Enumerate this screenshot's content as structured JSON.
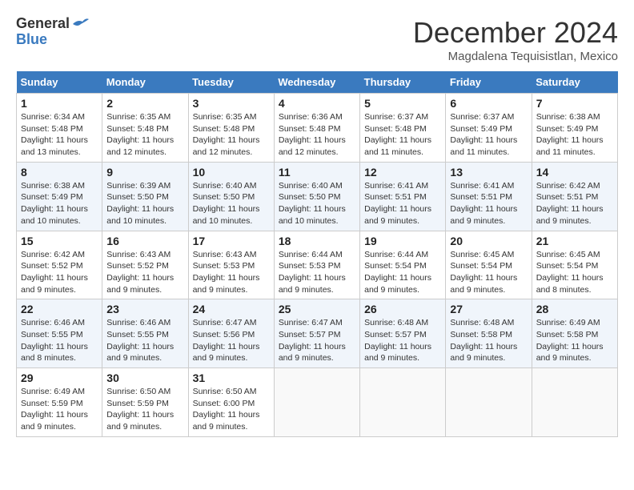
{
  "header": {
    "logo_line1": "General",
    "logo_line2": "Blue",
    "month_title": "December 2024",
    "location": "Magdalena Tequisistlan, Mexico"
  },
  "weekdays": [
    "Sunday",
    "Monday",
    "Tuesday",
    "Wednesday",
    "Thursday",
    "Friday",
    "Saturday"
  ],
  "weeks": [
    [
      {
        "day": "1",
        "sunrise": "6:34 AM",
        "sunset": "5:48 PM",
        "daylight": "11 hours and 13 minutes."
      },
      {
        "day": "2",
        "sunrise": "6:35 AM",
        "sunset": "5:48 PM",
        "daylight": "11 hours and 12 minutes."
      },
      {
        "day": "3",
        "sunrise": "6:35 AM",
        "sunset": "5:48 PM",
        "daylight": "11 hours and 12 minutes."
      },
      {
        "day": "4",
        "sunrise": "6:36 AM",
        "sunset": "5:48 PM",
        "daylight": "11 hours and 12 minutes."
      },
      {
        "day": "5",
        "sunrise": "6:37 AM",
        "sunset": "5:48 PM",
        "daylight": "11 hours and 11 minutes."
      },
      {
        "day": "6",
        "sunrise": "6:37 AM",
        "sunset": "5:49 PM",
        "daylight": "11 hours and 11 minutes."
      },
      {
        "day": "7",
        "sunrise": "6:38 AM",
        "sunset": "5:49 PM",
        "daylight": "11 hours and 11 minutes."
      }
    ],
    [
      {
        "day": "8",
        "sunrise": "6:38 AM",
        "sunset": "5:49 PM",
        "daylight": "11 hours and 10 minutes."
      },
      {
        "day": "9",
        "sunrise": "6:39 AM",
        "sunset": "5:50 PM",
        "daylight": "11 hours and 10 minutes."
      },
      {
        "day": "10",
        "sunrise": "6:40 AM",
        "sunset": "5:50 PM",
        "daylight": "11 hours and 10 minutes."
      },
      {
        "day": "11",
        "sunrise": "6:40 AM",
        "sunset": "5:50 PM",
        "daylight": "11 hours and 10 minutes."
      },
      {
        "day": "12",
        "sunrise": "6:41 AM",
        "sunset": "5:51 PM",
        "daylight": "11 hours and 9 minutes."
      },
      {
        "day": "13",
        "sunrise": "6:41 AM",
        "sunset": "5:51 PM",
        "daylight": "11 hours and 9 minutes."
      },
      {
        "day": "14",
        "sunrise": "6:42 AM",
        "sunset": "5:51 PM",
        "daylight": "11 hours and 9 minutes."
      }
    ],
    [
      {
        "day": "15",
        "sunrise": "6:42 AM",
        "sunset": "5:52 PM",
        "daylight": "11 hours and 9 minutes."
      },
      {
        "day": "16",
        "sunrise": "6:43 AM",
        "sunset": "5:52 PM",
        "daylight": "11 hours and 9 minutes."
      },
      {
        "day": "17",
        "sunrise": "6:43 AM",
        "sunset": "5:53 PM",
        "daylight": "11 hours and 9 minutes."
      },
      {
        "day": "18",
        "sunrise": "6:44 AM",
        "sunset": "5:53 PM",
        "daylight": "11 hours and 9 minutes."
      },
      {
        "day": "19",
        "sunrise": "6:44 AM",
        "sunset": "5:54 PM",
        "daylight": "11 hours and 9 minutes."
      },
      {
        "day": "20",
        "sunrise": "6:45 AM",
        "sunset": "5:54 PM",
        "daylight": "11 hours and 9 minutes."
      },
      {
        "day": "21",
        "sunrise": "6:45 AM",
        "sunset": "5:54 PM",
        "daylight": "11 hours and 8 minutes."
      }
    ],
    [
      {
        "day": "22",
        "sunrise": "6:46 AM",
        "sunset": "5:55 PM",
        "daylight": "11 hours and 8 minutes."
      },
      {
        "day": "23",
        "sunrise": "6:46 AM",
        "sunset": "5:55 PM",
        "daylight": "11 hours and 9 minutes."
      },
      {
        "day": "24",
        "sunrise": "6:47 AM",
        "sunset": "5:56 PM",
        "daylight": "11 hours and 9 minutes."
      },
      {
        "day": "25",
        "sunrise": "6:47 AM",
        "sunset": "5:57 PM",
        "daylight": "11 hours and 9 minutes."
      },
      {
        "day": "26",
        "sunrise": "6:48 AM",
        "sunset": "5:57 PM",
        "daylight": "11 hours and 9 minutes."
      },
      {
        "day": "27",
        "sunrise": "6:48 AM",
        "sunset": "5:58 PM",
        "daylight": "11 hours and 9 minutes."
      },
      {
        "day": "28",
        "sunrise": "6:49 AM",
        "sunset": "5:58 PM",
        "daylight": "11 hours and 9 minutes."
      }
    ],
    [
      {
        "day": "29",
        "sunrise": "6:49 AM",
        "sunset": "5:59 PM",
        "daylight": "11 hours and 9 minutes."
      },
      {
        "day": "30",
        "sunrise": "6:50 AM",
        "sunset": "5:59 PM",
        "daylight": "11 hours and 9 minutes."
      },
      {
        "day": "31",
        "sunrise": "6:50 AM",
        "sunset": "6:00 PM",
        "daylight": "11 hours and 9 minutes."
      },
      null,
      null,
      null,
      null
    ]
  ]
}
